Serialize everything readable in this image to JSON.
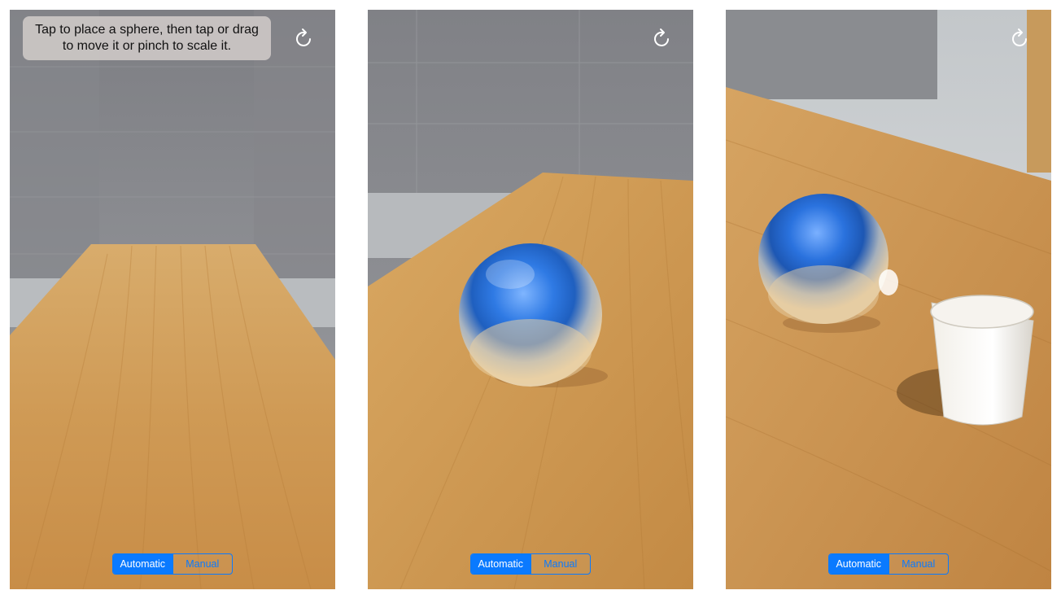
{
  "screens": [
    {
      "hint": {
        "line1": "Tap to place a sphere, then tap or drag",
        "line2": "to move it or pinch to scale it."
      },
      "reset_icon": "arrow-clockwise-icon",
      "segmented": {
        "options": [
          "Automatic",
          "Manual"
        ],
        "selected": "Automatic"
      }
    },
    {
      "reset_icon": "arrow-clockwise-icon",
      "segmented": {
        "options": [
          "Automatic",
          "Manual"
        ],
        "selected": "Automatic"
      }
    },
    {
      "reset_icon": "arrow-clockwise-icon",
      "segmented": {
        "options": [
          "Automatic",
          "Manual"
        ],
        "selected": "Automatic"
      }
    }
  ],
  "colors": {
    "accent": "#0a7aff",
    "table_wood": "#c8954f",
    "wall": "#8a8b8f",
    "sphere": "#1f66d6"
  }
}
